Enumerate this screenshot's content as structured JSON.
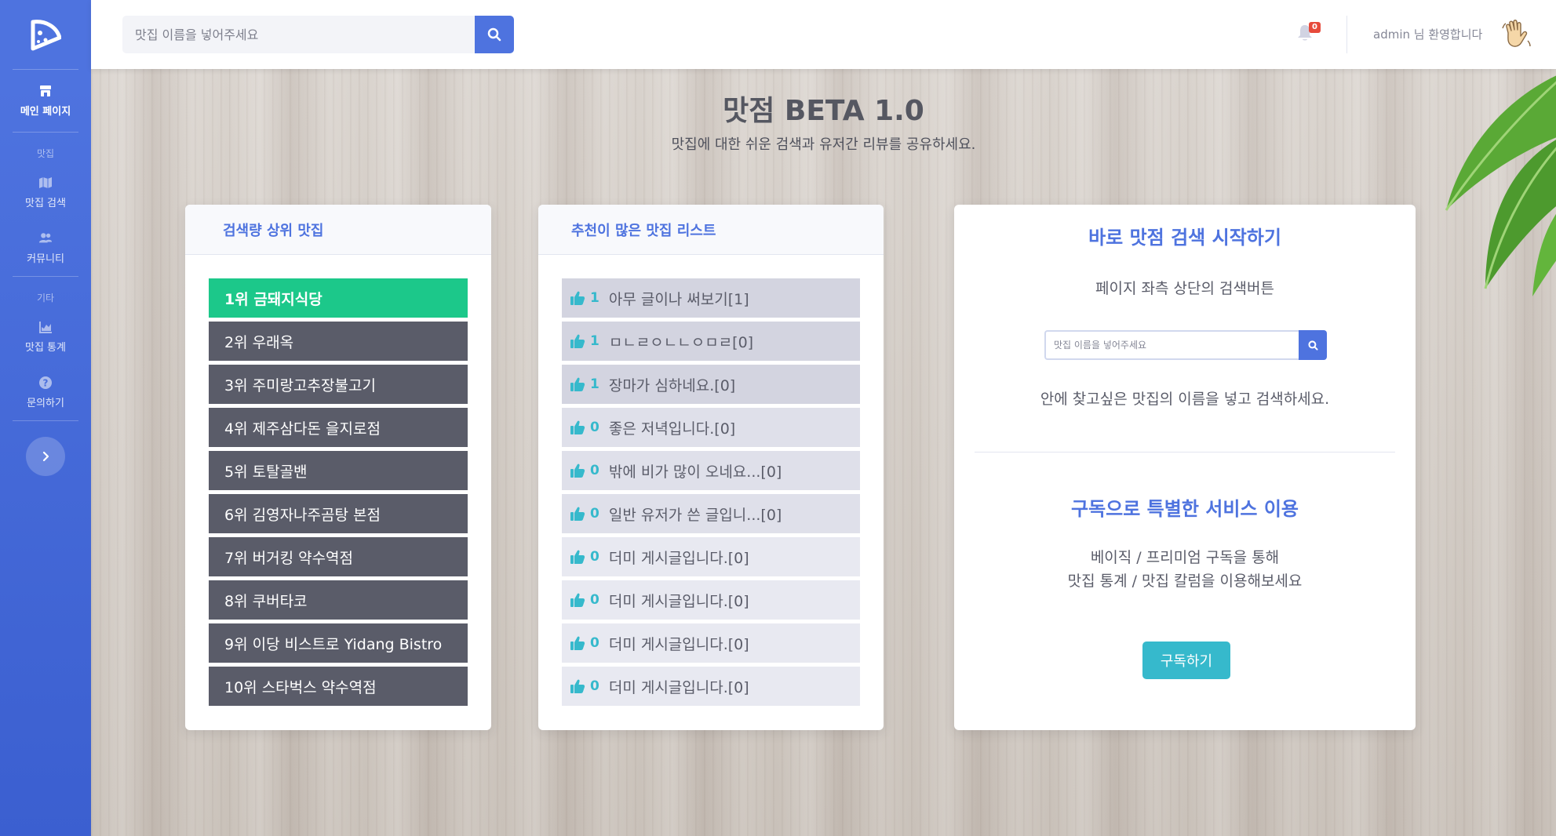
{
  "sidebar": {
    "brand_icon": "pizza-logo-icon",
    "items": [
      {
        "label": "메인 페이지",
        "icon": "store-icon"
      },
      {
        "label": "맛집 검색",
        "icon": "map-icon"
      },
      {
        "label": "커뮤니티",
        "icon": "users-icon"
      },
      {
        "label": "맛집 통계",
        "icon": "chart-area-icon"
      },
      {
        "label": "문의하기",
        "icon": "question-circle-icon"
      }
    ],
    "headings": [
      "맛집",
      "기타"
    ],
    "toggle_icon": "chevron-right-icon"
  },
  "topbar": {
    "search_placeholder": "맛집 이름을 넣어주세요",
    "notification_count": "0",
    "user_greeting": "admin 님 환영합니다",
    "wave_icon": "waving-hand-icon"
  },
  "hero": {
    "title": "맛점 BETA 1.0",
    "subtitle": "맛집에 대한 쉬운 검색과 유저간 리뷰를 공유하세요."
  },
  "top_restaurants": {
    "header": "검색량 상위 맛집",
    "items": [
      "1위 금돼지식당",
      "2위 우래옥",
      "3위 주미랑고추장불고기",
      "4위 제주삼다돈 을지로점",
      "5위 토탈골밴",
      "6위 김영자나주곰탕 본점",
      "7위 버거킹 약수역점",
      "8위 쿠버타코",
      "9위 이당 비스트로 Yidang Bistro",
      "10위 스타벅스 약수역점"
    ]
  },
  "recommended": {
    "header": "추천이 많은 맛집 리스트",
    "items": [
      {
        "count": "1",
        "text": "아무 글이나 써보기[1]",
        "bg": "#d3d4e0"
      },
      {
        "count": "1",
        "text": "ㅁㄴㄹㅇㄴㄴㅇㅁㄹ[0]",
        "bg": "#d3d4e0"
      },
      {
        "count": "1",
        "text": "장마가 심하네요.[0]",
        "bg": "#d3d4e0"
      },
      {
        "count": "0",
        "text": "좋은 저녁입니다.[0]",
        "bg": "#dfe0ea"
      },
      {
        "count": "0",
        "text": "밖에 비가 많이 오네요...[0]",
        "bg": "#dfe0ea"
      },
      {
        "count": "0",
        "text": "일반 유저가 쓴 글입니...[0]",
        "bg": "#dfe0ea"
      },
      {
        "count": "0",
        "text": "더미 게시글입니다.[0]",
        "bg": "#e8e9f1"
      },
      {
        "count": "0",
        "text": "더미 게시글입니다.[0]",
        "bg": "#e8e9f1"
      },
      {
        "count": "0",
        "text": "더미 게시글입니다.[0]",
        "bg": "#e8e9f1"
      },
      {
        "count": "0",
        "text": "더미 게시글입니다.[0]",
        "bg": "#e8e9f1"
      }
    ]
  },
  "quick_search": {
    "title": "바로 맛점 검색 시작하기",
    "line1": "페이지 좌측 상단의 검색버튼",
    "placeholder": "맛집 이름을 넣어주세요",
    "line2": "안에 찾고싶은 맛집의 이름을 넣고 검색하세요."
  },
  "subscription": {
    "title": "구독으로 특별한 서비스 이용",
    "line1": "베이직 / 프리미엄 구독을 통해",
    "line2": "맛집 통계 / 맛집 칼럼을 이용해보세요",
    "button": "구독하기"
  },
  "colors": {
    "primary": "#4e73df",
    "success": "#1cc88a",
    "info": "#36b9cc",
    "dark_item": "#5a5c69",
    "danger": "#e74a3b"
  }
}
